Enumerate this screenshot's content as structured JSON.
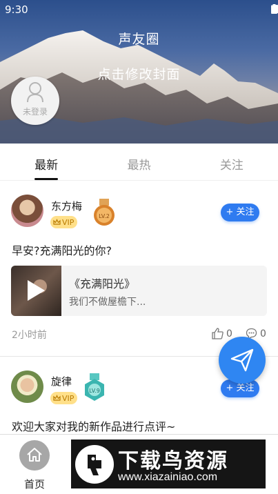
{
  "status_bar": {
    "time": "9:30",
    "icons": [
      "wifi-icon",
      "signal-icon",
      "battery-icon"
    ]
  },
  "cover": {
    "title": "声友圈",
    "edit_label": "点击修改封面",
    "login_label": "未登录"
  },
  "tabs": [
    {
      "label": "最新",
      "active": true
    },
    {
      "label": "最热",
      "active": false
    },
    {
      "label": "关注",
      "active": false
    }
  ],
  "posts": [
    {
      "author": "东方梅",
      "vip_label": "VIP",
      "medal": "LV.2",
      "follow_label": "关注",
      "text": "早安?充满阳光的你?",
      "music": {
        "title": "《充满阳光》",
        "desc": "我们不做屋檐下..."
      },
      "time": "2小时前",
      "likes": "0",
      "comments": "0"
    },
    {
      "author": "旋律",
      "vip_label": "VIP",
      "medal": "LV.9",
      "follow_label": "关注",
      "text": "欢迎大家对我的新作品进行点评~"
    }
  ],
  "bottom_bar": {
    "home_label": "首页"
  },
  "watermark": {
    "title": "下载鸟资源",
    "url": "www.xiazainiao.com"
  },
  "colors": {
    "accent": "#2f7bf0",
    "vip": "#ffe08a",
    "medal_gold": "#d9822b",
    "medal_teal": "#3bb5b0"
  }
}
